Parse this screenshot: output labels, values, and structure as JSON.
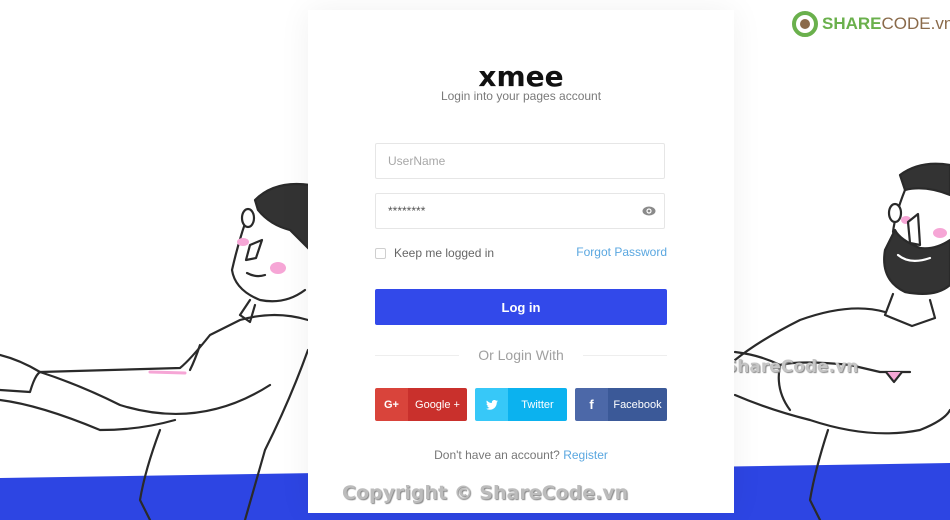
{
  "brand": {
    "logo_text": "xmee",
    "subtitle": "Login into your pages account",
    "accent": "#3249ea"
  },
  "form": {
    "username_placeholder": "UserName",
    "password_value": "********",
    "remember_label": "Keep me logged in",
    "remember_checked": false,
    "forgot_label": "Forgot Password",
    "login_label": "Log in",
    "divider_label": "Or Login With"
  },
  "social": [
    {
      "icon": "google-plus-icon",
      "glyph": "G+",
      "label": "Google +",
      "icon_bg": "#d9443b",
      "label_bg": "#c9302c"
    },
    {
      "icon": "twitter-icon",
      "glyph": "🐦",
      "label": "Twitter",
      "icon_bg": "#37c8f8",
      "label_bg": "#0bb2ef"
    },
    {
      "icon": "facebook-icon",
      "glyph": "f",
      "label": "Facebook",
      "icon_bg": "#4c68a8",
      "label_bg": "#3b5998"
    }
  ],
  "footer": {
    "question": "Don't have an account?",
    "register_label": "Register"
  },
  "watermarks": {
    "copyright": "Copyright © ShareCode.vn",
    "side": "ShareCode.vn",
    "brand_bold": "SHARE",
    "brand_rest": "CODE.vn"
  }
}
